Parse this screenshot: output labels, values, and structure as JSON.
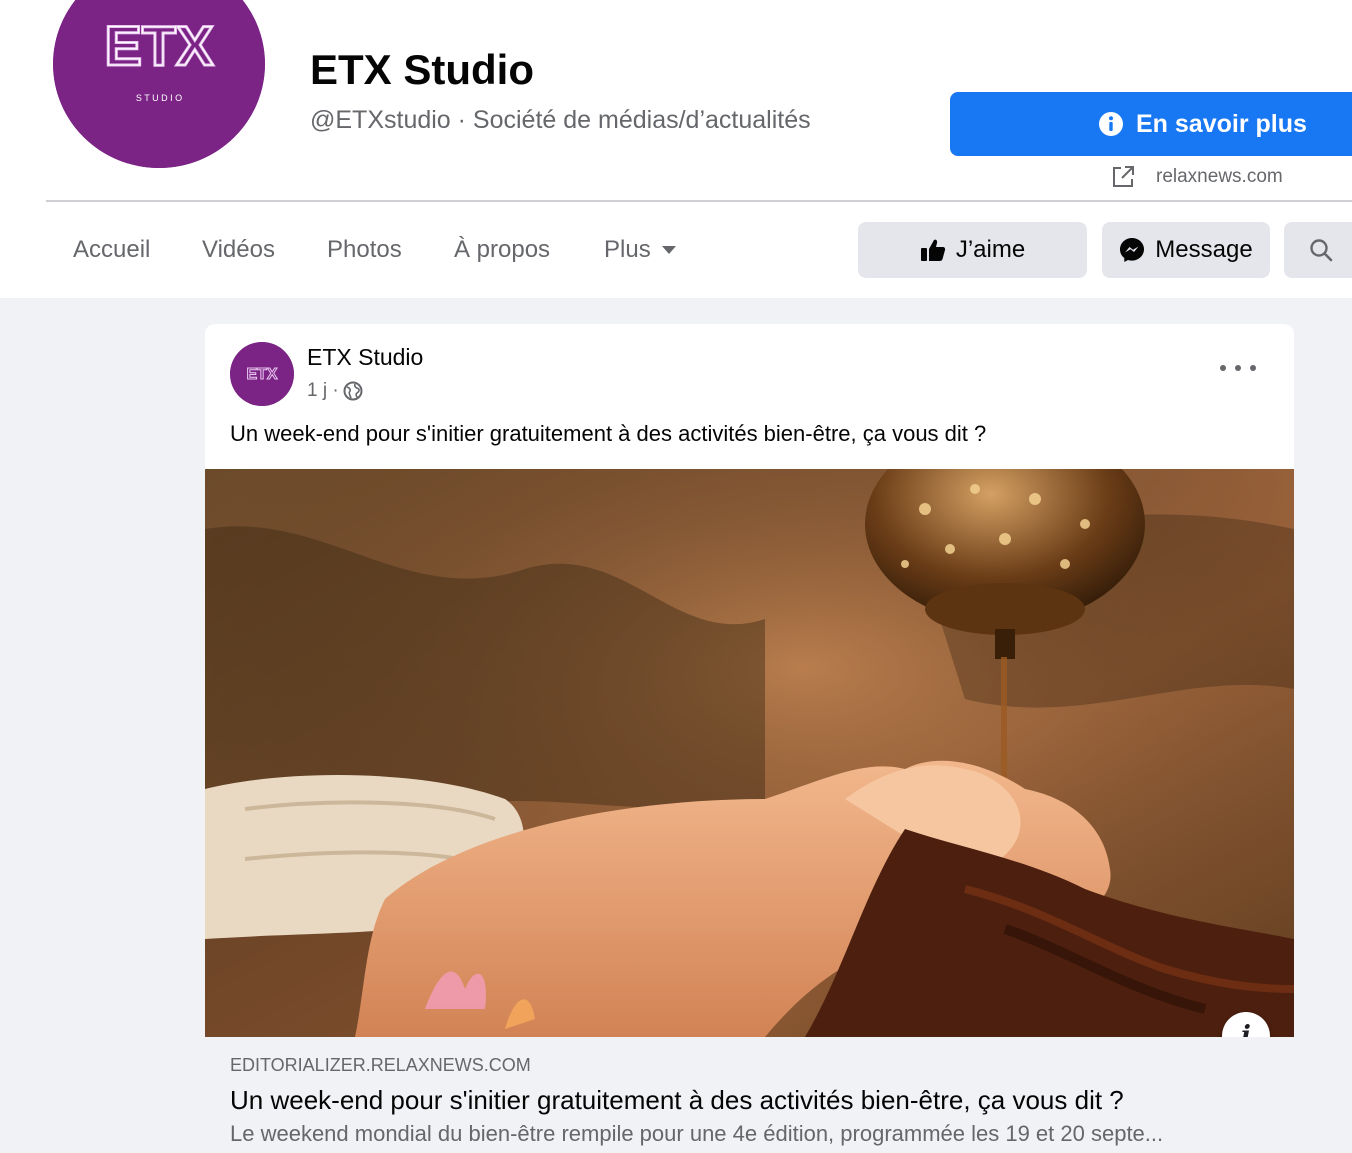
{
  "page": {
    "name": "ETX Studio",
    "subtitle": "@ETXstudio · Société de médias/d’actualités",
    "logo_text": "ETX",
    "logo_subtext": "S T U D I O"
  },
  "cta": {
    "label": "En savoir plus",
    "icon": "info-icon",
    "link": "relaxnews.com",
    "link_icon": "external-link-icon"
  },
  "nav": {
    "items": [
      "Accueil",
      "Vidéos",
      "Photos",
      "À propos",
      "Plus"
    ]
  },
  "actions": {
    "like": "J’aime",
    "message": "Message",
    "search_icon": "search-icon"
  },
  "post": {
    "author": "ETX Studio",
    "time": "1 j ·",
    "text": "Un week-end pour s'initier gratuitement à des activités bien-être, ça vous dit ?",
    "image_info": "i",
    "link": {
      "domain": "EDITORIALIZER.RELAXNEWS.COM",
      "title": "Un week-end pour s'initier gratuitement à des activités bien-être, ça vous dit ?",
      "description": "Le weekend mondial du bien-être rempile pour une 4e édition, programmée les 19 et 20 septe..."
    }
  },
  "colors": {
    "brand": "#7b2486",
    "primary": "#1877f2",
    "secondary_text": "#65676b",
    "background": "#f0f2f5"
  }
}
